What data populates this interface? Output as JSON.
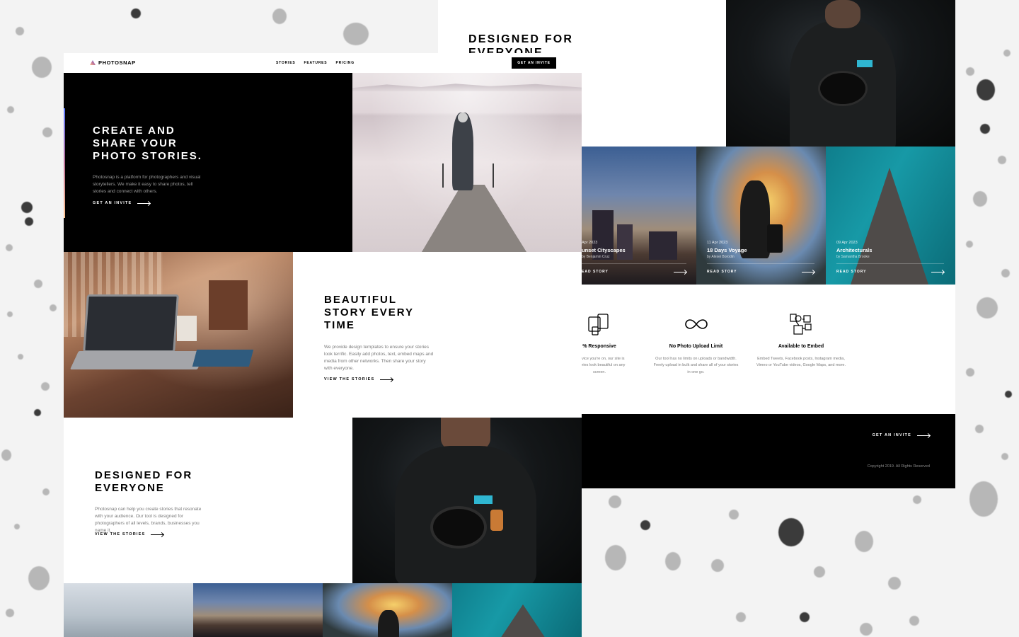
{
  "brand": {
    "name": "PHOTOSNAP"
  },
  "nav": {
    "stories": "STORIES",
    "features": "FEATURES",
    "pricing": "PRICING",
    "cta": "GET AN INVITE"
  },
  "hero": {
    "title_l1": "CREATE AND",
    "title_l2": "SHARE YOUR",
    "title_l3": "PHOTO STORIES.",
    "body": "Photosnap is a platform for photographers and visual storytellers. We make it easy to share photos, tell stories and connect with others.",
    "link": "GET AN INVITE"
  },
  "beautiful": {
    "title_l1": "BEAUTIFUL",
    "title_l2": "STORY EVERY",
    "title_l3": "TIME",
    "body": "We provide design templates to ensure your stories look terrific. Easily add photos, text, embed maps and media from other networks. Then share your story with everyone.",
    "link": "VIEW THE STORIES"
  },
  "designed": {
    "title_l1": "DESIGNED FOR",
    "title_l2": "EVERYONE",
    "body": "Photosnap can help you create stories that resonate with your audience. Our tool is designed for photographers of all levels, brands, businesses you name it.",
    "link": "VIEW THE STORIES"
  },
  "back": {
    "heading_l1": "DESIGNED FOR",
    "heading_l2": "EVERYONE",
    "stories": [
      {
        "date": "Apr 2023",
        "title": "unset Cityscapes",
        "author": "by Benjamin Cruz",
        "read": "EAD STORY"
      },
      {
        "date": "11 Apr 2023",
        "title": "18 Days Voyage",
        "author": "by Alexei Borodin",
        "read": "READ STORY"
      },
      {
        "date": "09 Apr 2023",
        "title": "Architecturals",
        "author": "by Samantha Brooke",
        "read": "READ STORY"
      }
    ],
    "features": [
      {
        "icon": "responsive-devices-icon",
        "title": "% Responsive",
        "desc_l1": "e device you're on, our site is",
        "desc_l2": "d stories look beautiful on any",
        "desc_l3": "screen."
      },
      {
        "icon": "infinity-icon",
        "title": "No Photo Upload Limit",
        "desc_l1": "Our tool has no limits on uploads or bandwidth.",
        "desc_l2": "Freely upload in bulk and share all of your stories",
        "desc_l3": "in one go."
      },
      {
        "icon": "embed-icon",
        "title": "Available to Embed",
        "desc_l1": "Embed Tweets, Facebook posts, Instagram media,",
        "desc_l2": "Vimeo or YouTube videos, Google Maps, and more.",
        "desc_l3": ""
      }
    ],
    "footer_link": "GET AN INVITE",
    "copyright": "Copyright 2019. All Rights Reserved"
  },
  "colors": {
    "accent_start": "#FFC593",
    "accent_mid": "#BC7198",
    "accent_end": "#5A77FF",
    "black": "#000000"
  }
}
